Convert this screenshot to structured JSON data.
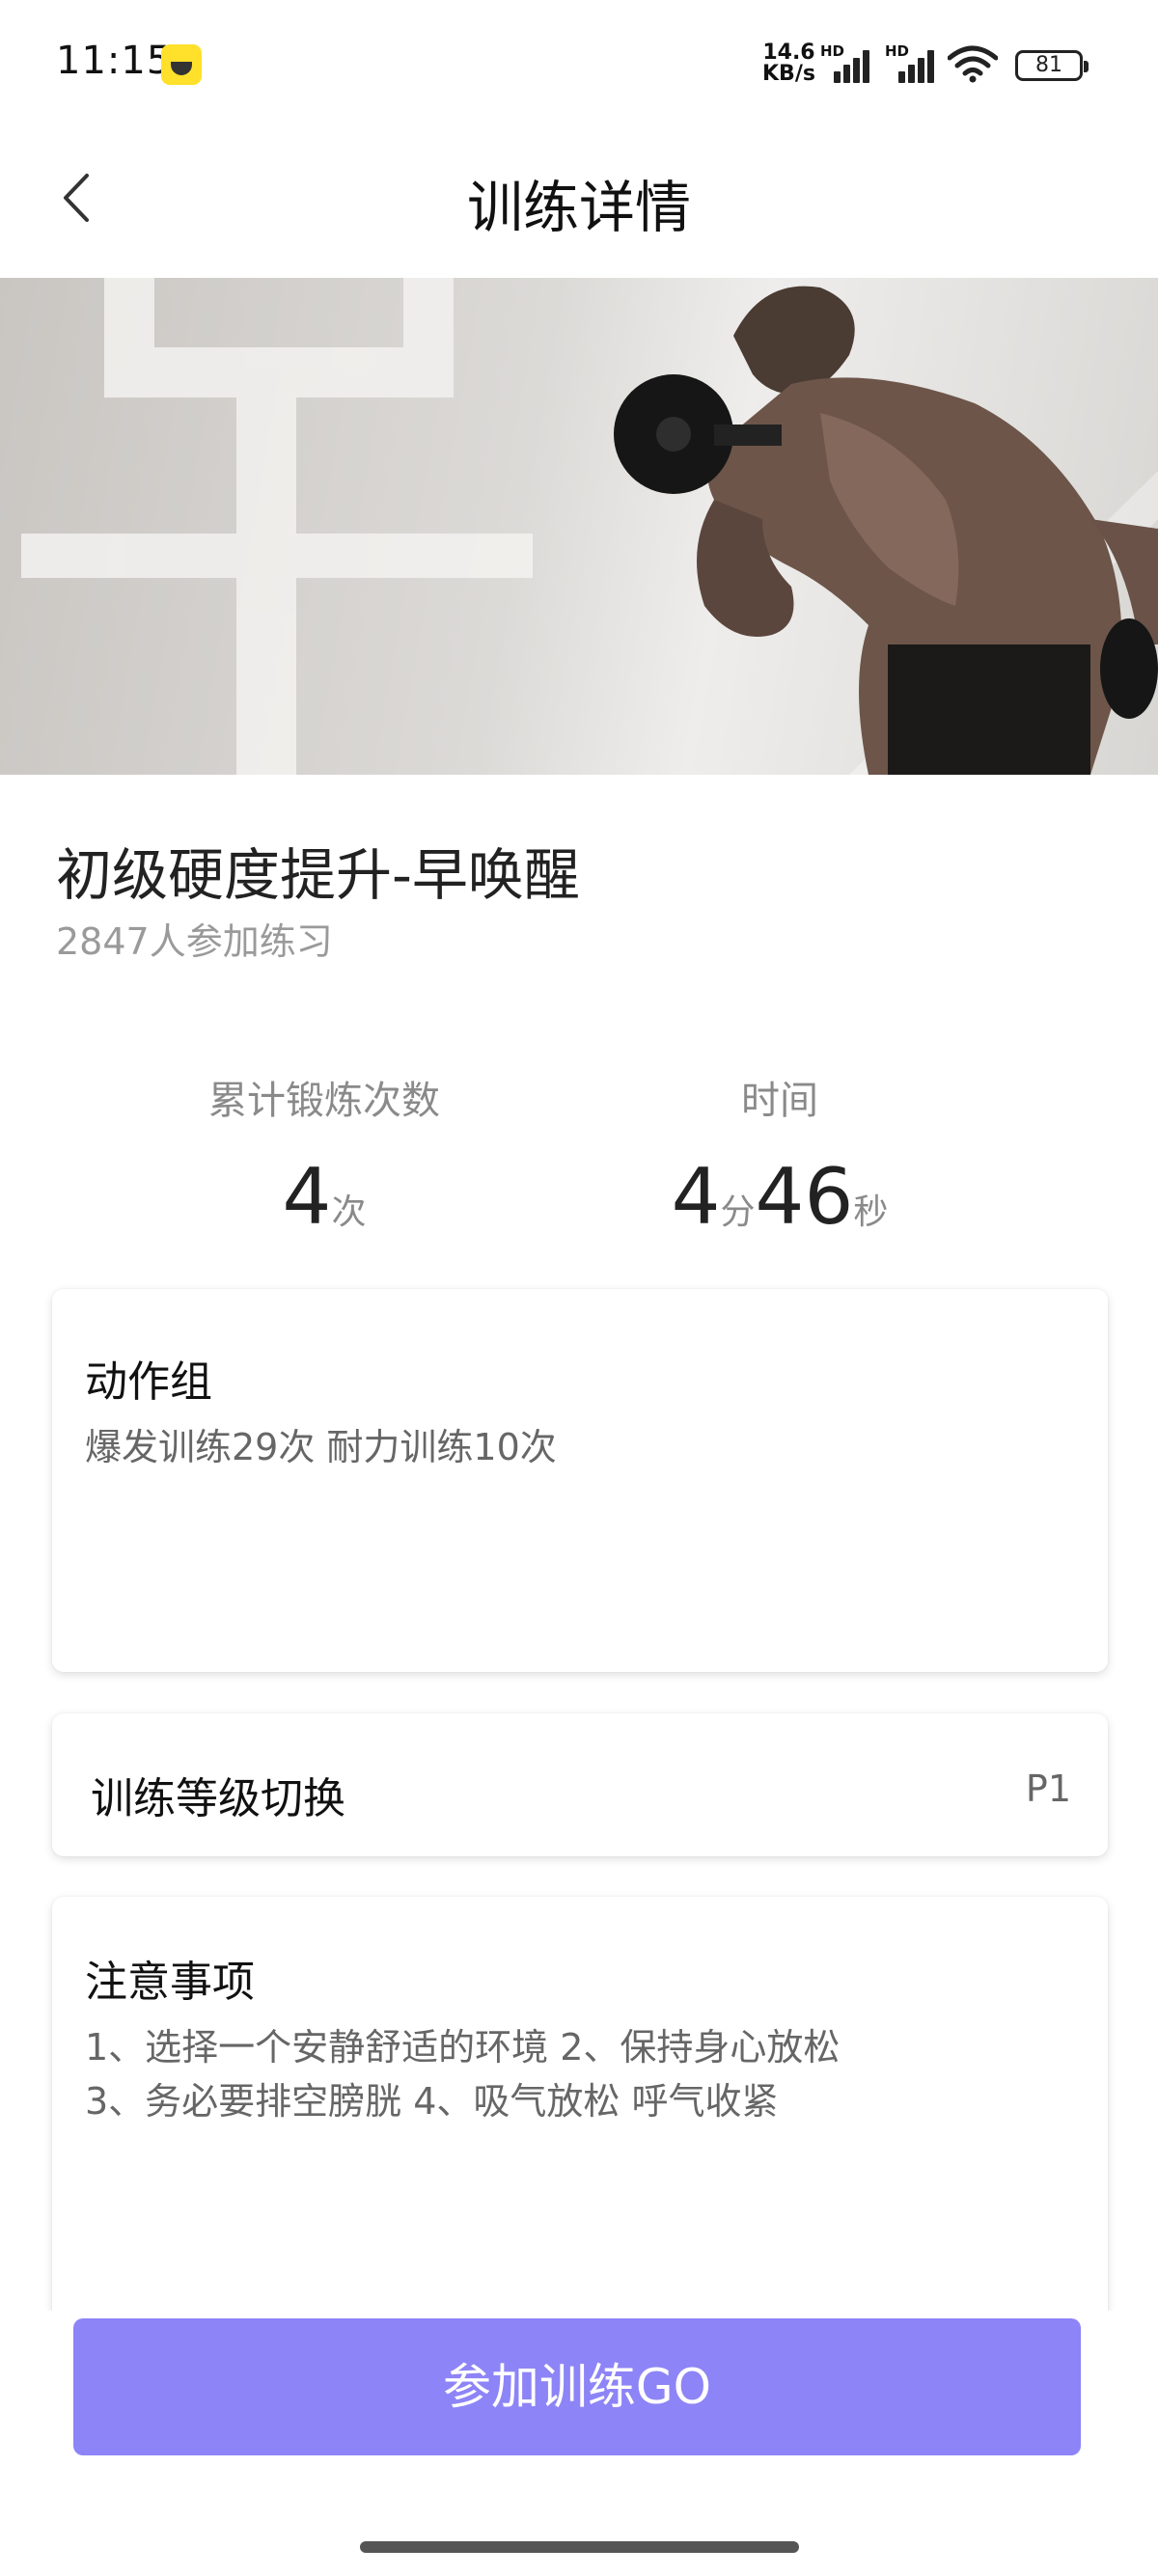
{
  "status_bar": {
    "time": "11:15",
    "net_speed_value": "14.6",
    "net_speed_unit": "KB/s",
    "hd_label": "HD",
    "battery": "81",
    "icons": [
      "app-notification-icon",
      "signal-icon",
      "signal-icon",
      "wifi-icon",
      "battery-icon"
    ]
  },
  "nav": {
    "back_icon": "chevron-left-icon",
    "title": "训练详情"
  },
  "hero": {
    "watermark_char": "早"
  },
  "course": {
    "title": "初级硬度提升-早唤醒",
    "participants": "2847人参加练习"
  },
  "stats": {
    "count_label": "累计锻炼次数",
    "count_value": "4",
    "count_unit": "次",
    "time_label": "时间",
    "minutes": "4",
    "minutes_unit": "分",
    "seconds": "46",
    "seconds_unit": "秒"
  },
  "action_group": {
    "title": "动作组",
    "description": "爆发训练29次 耐力训练10次"
  },
  "level_switch": {
    "label": "训练等级切换",
    "value": "P1"
  },
  "notes": {
    "title": "注意事项",
    "line1": "1、选择一个安静舒适的环境  2、保持身心放松",
    "line2": "3、务必要排空膀胱  4、吸气放松 呼气收紧"
  },
  "cta": {
    "label": "参加训练GO",
    "color": "#8d84f7"
  }
}
